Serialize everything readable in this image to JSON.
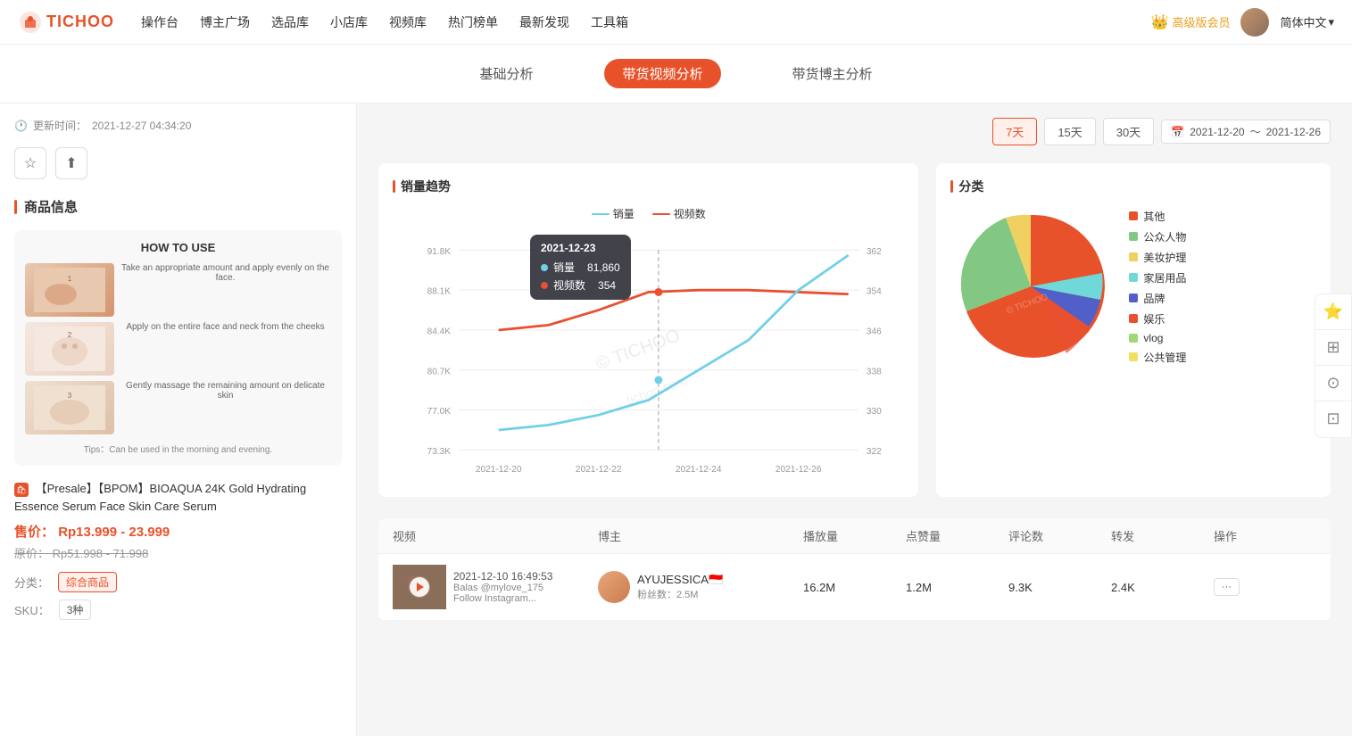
{
  "nav": {
    "logo_text": "TICHOO",
    "links": [
      "操作台",
      "博主广场",
      "选品库",
      "小店库",
      "视频库",
      "热门榜单",
      "最新发现",
      "工具箱"
    ],
    "vip_label": "高级版会员",
    "lang_label": "简体中文"
  },
  "tabs": {
    "items": [
      {
        "label": "基础分析",
        "active": false
      },
      {
        "label": "带货视频分析",
        "active": true
      },
      {
        "label": "带货博主分析",
        "active": false
      }
    ]
  },
  "sidebar": {
    "update_label": "更新时间：",
    "update_time": "2021-12-27 04:34:20",
    "section_title": "商品信息",
    "how_to_use": "HOW TO USE",
    "tips": "Tips：Can be used in the morning and evening.",
    "product_name": "【Presale】【BPOM】BIOAQUA 24K Gold Hydrating Essence Serum Face Skin Care Serum",
    "sale_price_label": "售价：",
    "sale_price": "Rp13.999 - 23.999",
    "original_price_label": "原价：",
    "original_price": "Rp51.998 - 71.998",
    "category_label": "分类：",
    "category_tag": "综合商品",
    "sku_label": "SKU：",
    "sku_value": "3种"
  },
  "filter": {
    "btn_7": "7天",
    "btn_15": "15天",
    "btn_30": "30天",
    "date_from": "2021-12-20",
    "date_to": "2021-12-26"
  },
  "sales_chart": {
    "title": "销量趋势",
    "legend_sales": "销量",
    "legend_videos": "视频数",
    "tooltip": {
      "date": "2021-12-23",
      "sales_label": "销量",
      "sales_value": "81,860",
      "videos_label": "视频数",
      "videos_value": "354"
    },
    "y_left": [
      "91.8K",
      "88.1K",
      "84.4K",
      "80.7K",
      "77.0K",
      "73.3K"
    ],
    "y_right": [
      "362",
      "354",
      "346",
      "338",
      "330",
      "322"
    ],
    "x_labels": [
      "2021-12-20",
      "2021-12-22",
      "2021-12-24",
      "2021-12-26"
    ]
  },
  "pie_chart": {
    "title": "分类",
    "legend": [
      {
        "label": "其他",
        "color": "#e8522a"
      },
      {
        "label": "公众人物",
        "color": "#82c882"
      },
      {
        "label": "美妆护理",
        "color": "#f0d060"
      },
      {
        "label": "家居用品",
        "color": "#70d8d8"
      },
      {
        "label": "品牌",
        "color": "#5060c8"
      },
      {
        "label": "娱乐",
        "color": "#e85030"
      },
      {
        "label": "vlog",
        "color": "#a0d878"
      },
      {
        "label": "公共管理",
        "color": "#f0e060"
      }
    ]
  },
  "table": {
    "headers": [
      "视频",
      "博主",
      "播放量",
      "点赞量",
      "评论数",
      "转发",
      "操作"
    ],
    "rows": [
      {
        "video_time": "2021-12-10 16:49:53",
        "blogger_name": "Balas @mylove_175",
        "blogger_sub": "Follow Instagram...",
        "blogger_id": "AYUJESSICA🇮🇩",
        "fans": "粉丝数：2.5M",
        "plays": "16.2M",
        "likes": "1.2M",
        "comments": "9.3K",
        "shares": "2.4K"
      }
    ]
  },
  "watermark": "© TICHOO",
  "watermark2": "tichoo.com"
}
